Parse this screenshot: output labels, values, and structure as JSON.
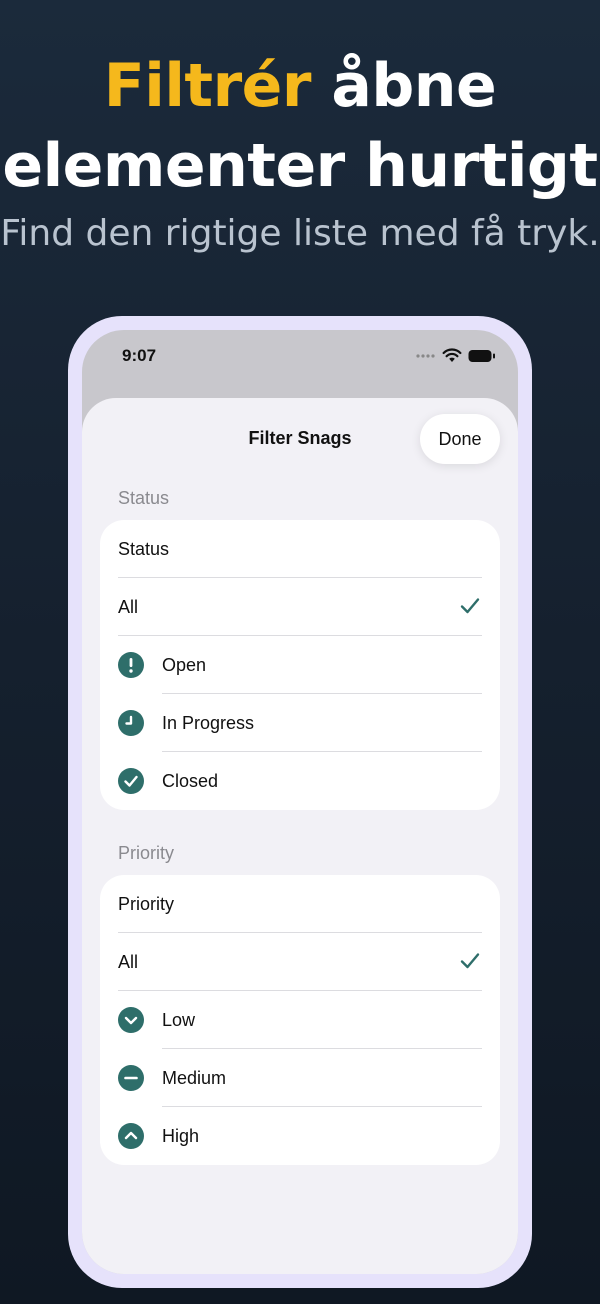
{
  "promo": {
    "headline_accent": "Filtrér",
    "headline_rest": "åbne",
    "headline_line2": "elementer hurtigt",
    "subtitle": "Find den rigtige liste med få tryk."
  },
  "status_bar": {
    "time": "9:07"
  },
  "sheet": {
    "title": "Filter Snags",
    "done_label": "Done"
  },
  "status_section": {
    "header": "Status",
    "picker_label": "Status",
    "options": [
      {
        "label": "All",
        "selected": true
      },
      {
        "label": "Open",
        "icon": "exclamation-icon"
      },
      {
        "label": "In Progress",
        "icon": "clock-icon"
      },
      {
        "label": "Closed",
        "icon": "checkmark-circle-icon"
      }
    ]
  },
  "priority_section": {
    "header": "Priority",
    "picker_label": "Priority",
    "options": [
      {
        "label": "All",
        "selected": true
      },
      {
        "label": "Low",
        "icon": "chevron-down-circle-icon"
      },
      {
        "label": "Medium",
        "icon": "minus-circle-icon"
      },
      {
        "label": "High",
        "icon": "chevron-up-circle-icon"
      }
    ]
  },
  "colors": {
    "accent_yellow": "#f5b81c",
    "icon_teal": "#2e6e6a",
    "background_navy": "#1b2a3b",
    "phone_frame": "#e6e2fb"
  }
}
